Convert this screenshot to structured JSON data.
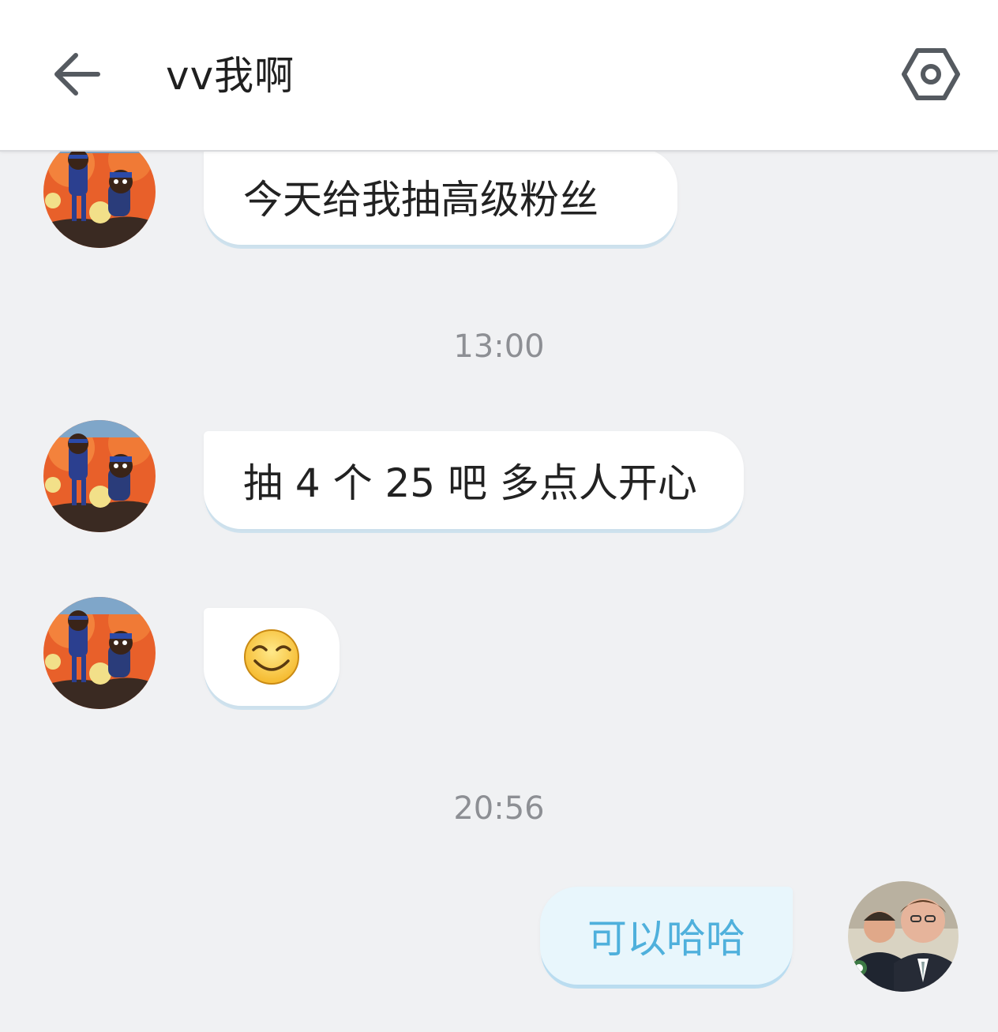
{
  "header": {
    "title": "vv我啊",
    "back_icon": "arrow-left-icon",
    "settings_icon": "hexagon-gear-icon"
  },
  "messages": [
    {
      "sender": "other",
      "type": "text",
      "text": "今天给我抽高级粉丝"
    },
    {
      "type": "timestamp",
      "text": "13:00"
    },
    {
      "sender": "other",
      "type": "text",
      "text": "抽 4 个 25 吧 多点人开心"
    },
    {
      "sender": "other",
      "type": "emoji",
      "emoji": "grinning-squint-emoji"
    },
    {
      "type": "timestamp",
      "text": "20:56"
    },
    {
      "sender": "me",
      "type": "text",
      "text": "可以哈哈"
    }
  ],
  "colors": {
    "background": "#f0f1f3",
    "header_bg": "#ffffff",
    "other_bubble": "#ffffff",
    "my_bubble": "#e8f6fc",
    "my_text": "#4fb0dc",
    "timestamp_text": "#8d8f94"
  }
}
